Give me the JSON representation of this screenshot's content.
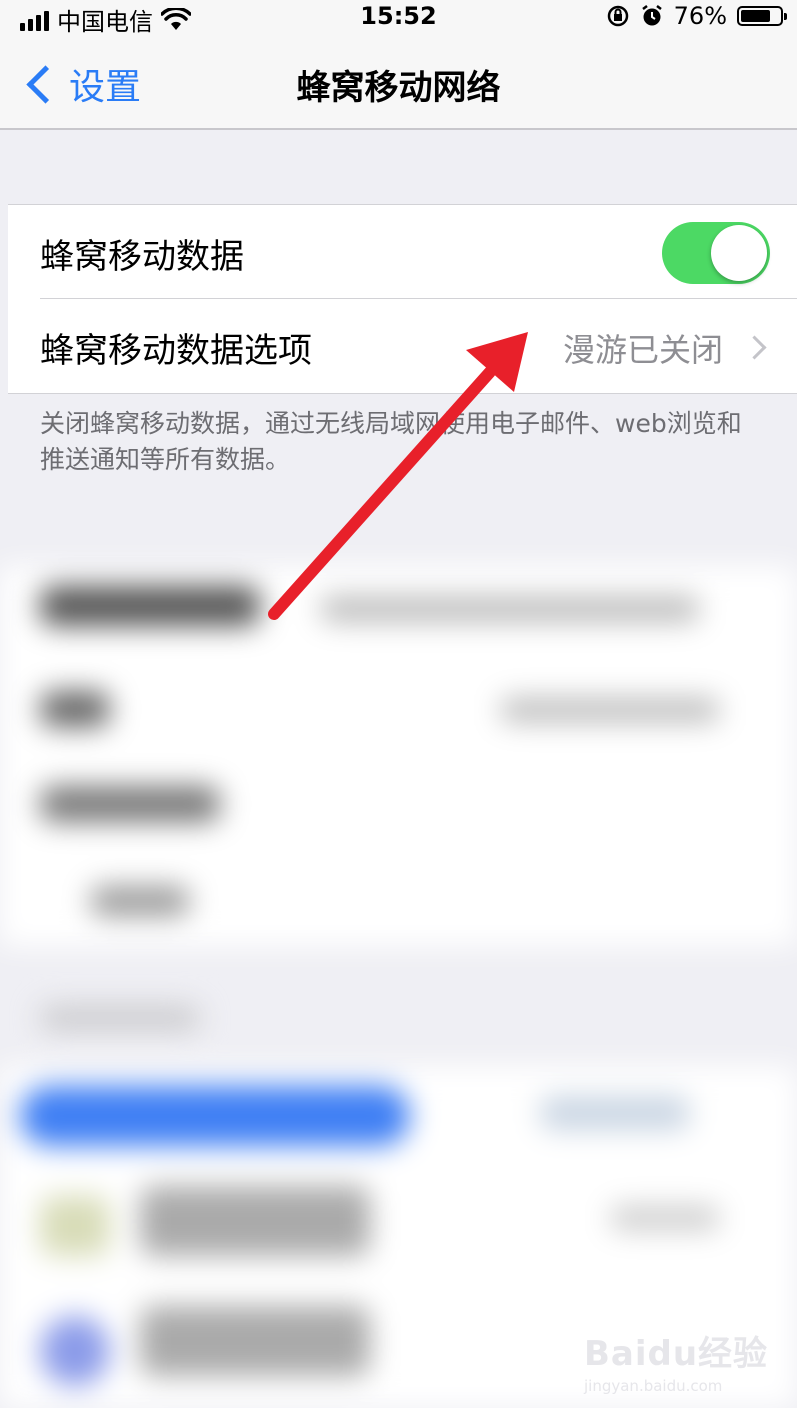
{
  "status_bar": {
    "carrier": "中国电信",
    "time": "15:52",
    "battery_percent": "76%",
    "battery_level": 0.76,
    "icons": [
      "signal-icon",
      "wifi-icon",
      "orientation-lock-icon",
      "alarm-icon",
      "battery-icon"
    ]
  },
  "nav": {
    "back_label": "设置",
    "title": "蜂窝移动网络"
  },
  "cellular": {
    "data_label": "蜂窝移动数据",
    "data_enabled": true,
    "options_label": "蜂窝移动数据选项",
    "options_value": "漫游已关闭"
  },
  "footer_note": "关闭蜂窝移动数据，通过无线局域网使用电子邮件、web浏览和推送通知等所有数据。",
  "watermark": {
    "main": "Baidu经验",
    "sub": "jingyan.baidu.com"
  },
  "colors": {
    "accent": "#2a7cf6",
    "toggle_on": "#4cd964",
    "annotation_arrow": "#e8202a"
  }
}
